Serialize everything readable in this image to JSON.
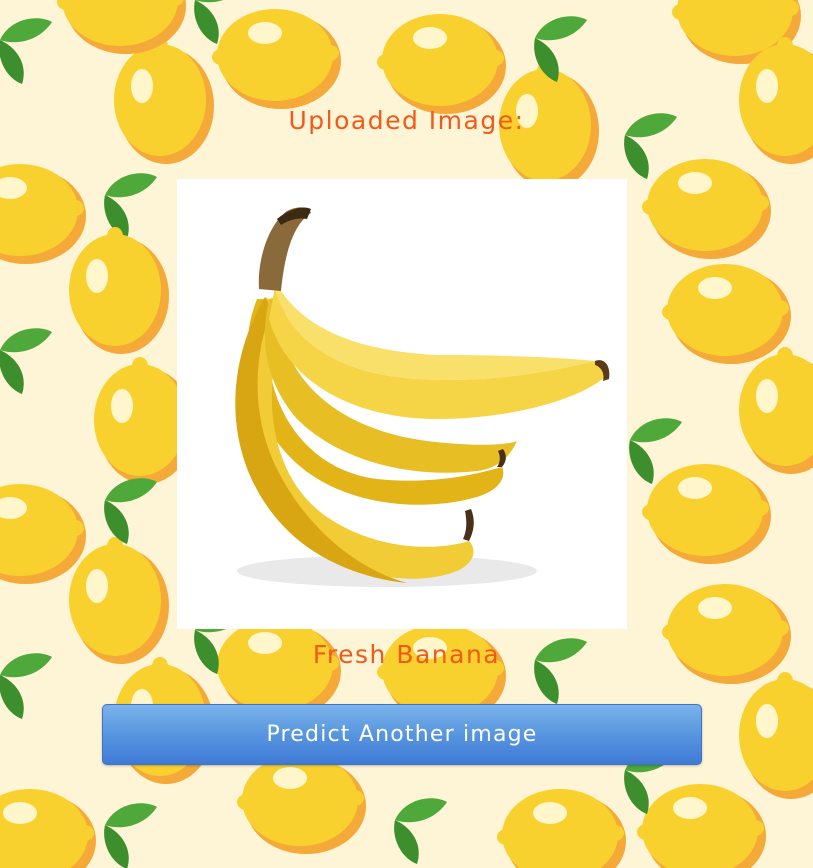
{
  "page": {
    "heading": "Uploaded Image:",
    "prediction": "Fresh Banana",
    "button_label": "Predict Another image"
  },
  "colors": {
    "background": "#fdf5d6",
    "heading_text": "#f15a1a",
    "button_top": "#7bb3ea",
    "button_bottom": "#3f7ad6",
    "lemon": "#f9d12e",
    "lemon_shadow": "#f4a938",
    "leaf": "#4ea83a"
  },
  "image": {
    "subject": "banana-bunch"
  }
}
